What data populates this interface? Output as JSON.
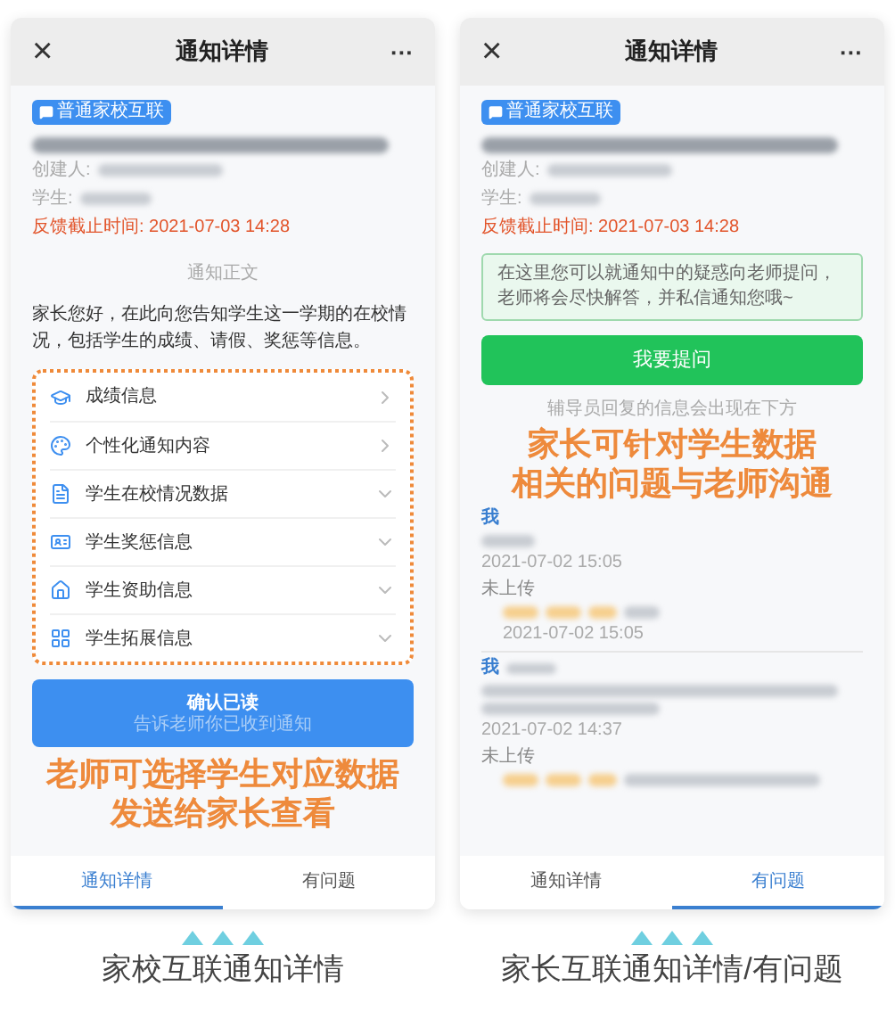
{
  "panels": [
    {
      "header": {
        "close": "×",
        "title": "通知详情",
        "more": "···"
      },
      "tag": "普通家校互联",
      "creator_label": "创建人:",
      "student_label": "学生:",
      "deadline": "反馈截止时间: 2021-07-03 14:28",
      "kind": "teacher",
      "section_label": "通知正文",
      "body": "家长您好，在此向您告知学生这一学期的在校情况，包括学生的成绩、请假、奖惩等信息。",
      "items": [
        {
          "label": "成绩信息",
          "kind": "link"
        },
        {
          "label": "个性化通知内容",
          "kind": "link"
        },
        {
          "label": "学生在校情况数据",
          "kind": "expand"
        },
        {
          "label": "学生奖惩信息",
          "kind": "expand"
        },
        {
          "label": "学生资助信息",
          "kind": "expand"
        },
        {
          "label": "学生拓展信息",
          "kind": "expand"
        }
      ],
      "confirm": {
        "title": "确认已读",
        "subtitle": "告诉老师你已收到通知"
      },
      "annotation": [
        "老师可选择学生对应数据",
        "发送给家长查看"
      ],
      "tabs": [
        {
          "label": "通知详情",
          "selected": true
        },
        {
          "label": "有问题",
          "selected": false
        }
      ],
      "caption": "家校互联通知详情"
    },
    {
      "header": {
        "close": "×",
        "title": "通知详情",
        "more": "···"
      },
      "tag": "普通家校互联",
      "creator_label": "创建人:",
      "student_label": "学生:",
      "deadline": "反馈截止时间: 2021-07-03 14:28",
      "kind": "parent",
      "notice": "在这里您可以就通知中的疑惑向老师提问，老师将会尽快解答，并私信通知您哦~",
      "ask_button": "我要提问",
      "reply_hint": "辅导员回复的信息会出现在下方",
      "annotation": [
        "家长可针对学生数据",
        "相关的问题与老师沟通"
      ],
      "messages": [
        {
          "sender": "我",
          "date": "2021-07-02 15:05",
          "status": "未上传",
          "reply_date": "2021-07-02 15:05"
        },
        {
          "sender": "我",
          "date": "2021-07-02 14:37",
          "status": "未上传"
        }
      ],
      "tabs": [
        {
          "label": "通知详情",
          "selected": false
        },
        {
          "label": "有问题",
          "selected": true
        }
      ],
      "caption": "家长互联通知详情/有问题"
    }
  ]
}
